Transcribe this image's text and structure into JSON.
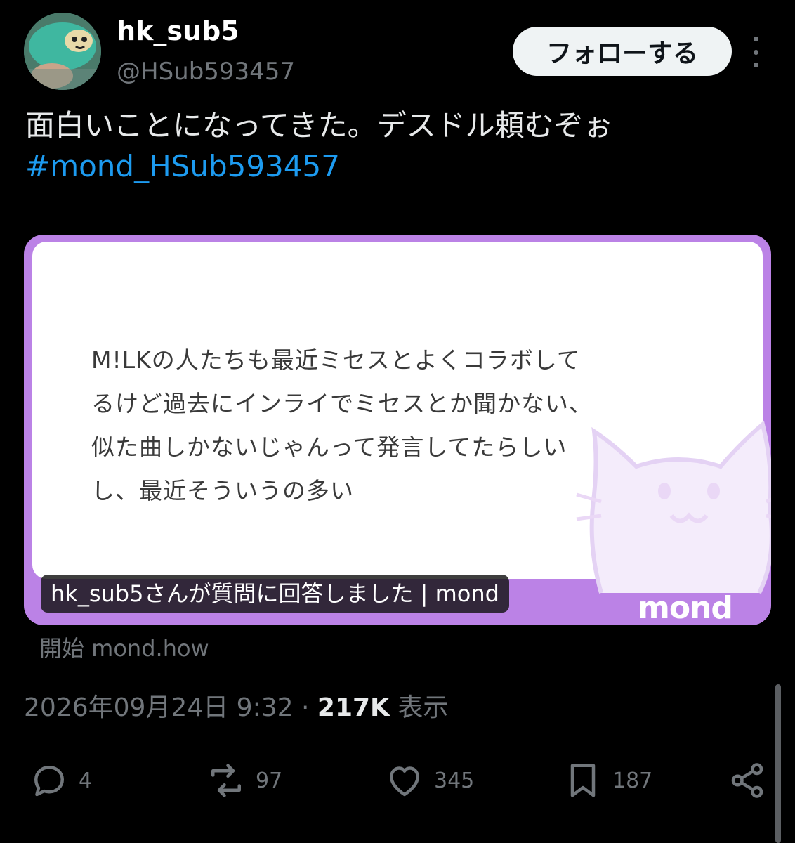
{
  "author": {
    "display_name": "hk_sub5",
    "handle": "@HSub593457"
  },
  "follow_label": "フォローする",
  "tweet": {
    "text": "面白いことになってきた。デスドル頼むぞぉ",
    "hashtag": "#mond_HSub593457"
  },
  "card": {
    "question_lines": [
      "M!LKの人たちも最近ミセスとよくコラボして",
      "るけど過去にインライでミセスとか聞かない、",
      "似た曲しかないじゃんって発言してたらしい",
      "し、最近そういうの多い"
    ],
    "caption": "hk_sub5さんが質問に回答しました | mond",
    "logo": "mond",
    "source": "開始 mond.how",
    "colors": {
      "frame": "#bb82e6",
      "inner": "#ffffff"
    }
  },
  "meta": {
    "timestamp": "2026年09月24日 9:32",
    "separator": "·",
    "views_count": "217K",
    "views_label": "表示"
  },
  "actions": {
    "replies": "4",
    "reposts": "97",
    "likes": "345",
    "bookmarks": "187"
  },
  "icons": [
    "reply-icon",
    "repost-icon",
    "like-icon",
    "bookmark-icon",
    "share-icon",
    "more-icon"
  ],
  "colors": {
    "accent": "#1d9bf0",
    "muted": "#71767b",
    "text": "#e7e9ea",
    "background": "#000000"
  }
}
